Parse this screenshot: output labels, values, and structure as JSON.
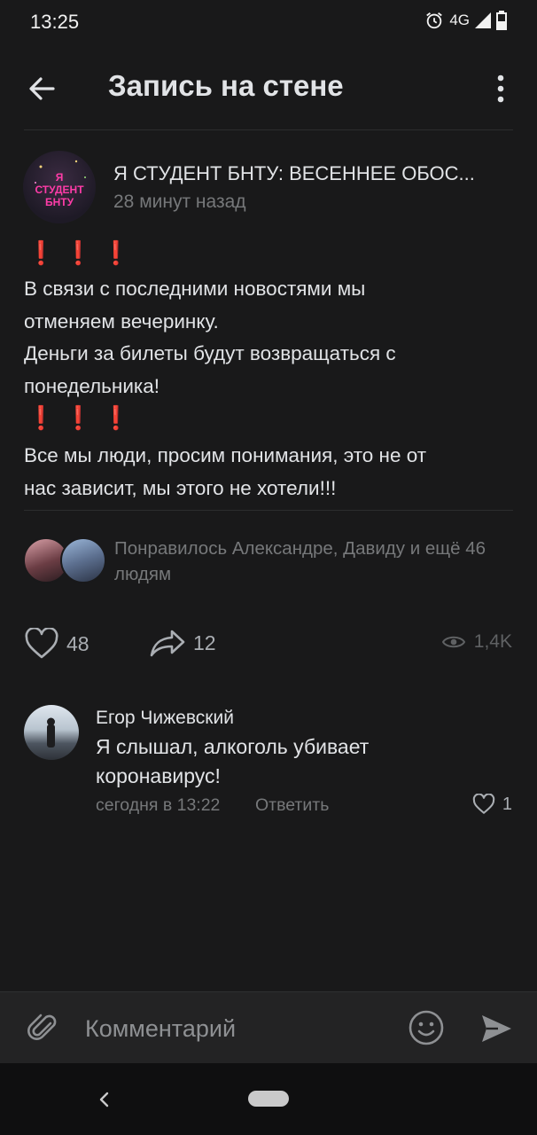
{
  "status_bar": {
    "time": "13:25",
    "network": "4G",
    "icons": [
      "alarm-icon",
      "signal-icon",
      "battery-icon"
    ]
  },
  "header": {
    "title": "Запись на стене",
    "icons": [
      "back-arrow-icon",
      "more-vertical-icon"
    ]
  },
  "post": {
    "author": "Я СТУДЕНТ БНТУ: ВЕСЕННЕЕ  ОБОС...",
    "avatar_text": [
      "Я",
      "СТУДЕНТ",
      "БНТУ"
    ],
    "time": "28 минут назад",
    "exclamations": "❗❗❗",
    "paragraph1": [
      "В связи с последними новостями мы",
      "отменяем вечеринку.",
      "Деньги за билеты будут возвращаться с",
      "понедельника!"
    ],
    "paragraph2": [
      "Все мы люди, просим понимания, это не от",
      "нас зависит, мы этого не хотели!!!"
    ],
    "liked_by": "Понравилось Александре, Давиду и ещё 46 людям",
    "likes": "48",
    "shares": "12",
    "views": "1,4K"
  },
  "comment": {
    "author": "Егор Чижевский",
    "text": [
      "Я слышал, алкоголь убивает",
      "коронавирус!"
    ],
    "time": "сегодня в 13:22",
    "reply_label": "Ответить",
    "likes": "1"
  },
  "composer": {
    "placeholder": "Комментарий",
    "icons": [
      "attach-icon",
      "emoji-icon",
      "send-icon"
    ]
  },
  "colors": {
    "background": "#19191a",
    "text": "#e1e3e6",
    "secondary": "#76787a",
    "accent_red": "#e64646"
  }
}
